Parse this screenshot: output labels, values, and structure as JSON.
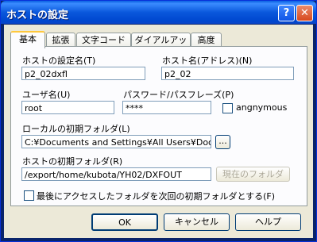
{
  "window": {
    "title": "ホストの設定",
    "help_label": "?",
    "close_label": "✕"
  },
  "tabs": [
    "基本",
    "拡張",
    "文字コード",
    "ダイアルアップ",
    "高度"
  ],
  "form": {
    "host_setting_name_label": "ホストの設定名(T)",
    "host_setting_name_value": "p2_02dxfl",
    "host_name_label": "ホスト名(アドレス)(N)",
    "host_name_value": "p2_02",
    "user_label": "ユーザ名(U)",
    "user_value": "root",
    "password_label": "パスワード/パスフレーズ(P)",
    "password_value": "****",
    "anonymous_label": "angnymous",
    "local_folder_label": "ローカルの初期フォルダ(L)",
    "local_folder_value": "C:¥Documents and Settings¥All Users¥Docum",
    "browse_label": "...",
    "remote_folder_label": "ホストの初期フォルダ(R)",
    "remote_folder_value": "/export/home/kubota/YH02/DXFOUT",
    "current_folder_label": "現在のフォルダ",
    "save_last_label": "最後にアクセスしたフォルダを次回の初期フォルダとする(F)"
  },
  "buttons": {
    "ok": "OK",
    "cancel": "キャンセル",
    "help": "ヘルプ"
  }
}
